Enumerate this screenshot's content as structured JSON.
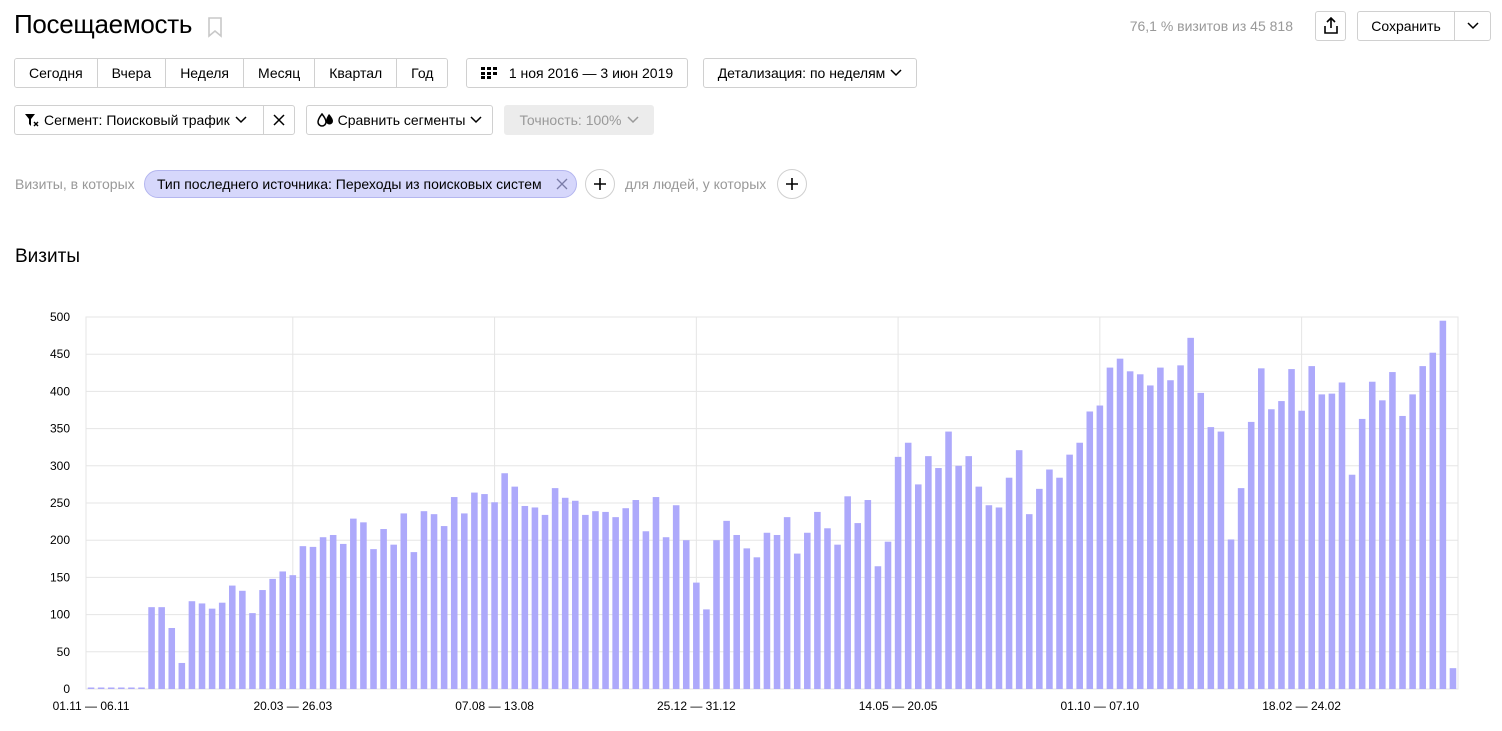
{
  "header": {
    "title": "Посещаемость",
    "stats": "76,1 % визитов из 45 818",
    "save_label": "Сохранить"
  },
  "period_buttons": [
    {
      "label": "Сегодня"
    },
    {
      "label": "Вчера"
    },
    {
      "label": "Неделя"
    },
    {
      "label": "Месяц"
    },
    {
      "label": "Квартал"
    },
    {
      "label": "Год"
    }
  ],
  "date_range": "1 ноя 2016 — 3 июн 2019",
  "detail": "Детализация: по неделям",
  "segment": {
    "label": "Сегмент: Поисковый трафик",
    "compare_label": "Сравнить сегменты",
    "accuracy_label": "Точность: 100%"
  },
  "filters": {
    "visits_label": "Визиты, в которых",
    "chip_label": "Тип последнего источника: Переходы из поисковых систем",
    "people_label": "для людей, у которых"
  },
  "icons": [
    "bookmark-icon",
    "share-icon",
    "chevron-down-icon",
    "calendar-icon",
    "filter-icon",
    "close-icon",
    "compare-icon",
    "plus-icon"
  ],
  "colors": {
    "bar": "#ada9fb",
    "grid": "#e5e5e5",
    "chip_bg": "#d6d7fb"
  },
  "chart_data": {
    "type": "bar",
    "title": "Визиты",
    "ylim": [
      0,
      500
    ],
    "yticks": [
      0,
      50,
      100,
      150,
      200,
      250,
      300,
      350,
      400,
      450,
      500
    ],
    "x_tick_labels": [
      {
        "index": 0,
        "label": "01.11 — 06.11"
      },
      {
        "index": 20,
        "label": "20.03 — 26.03"
      },
      {
        "index": 40,
        "label": "07.08 — 13.08"
      },
      {
        "index": 60,
        "label": "25.12 — 31.12"
      },
      {
        "index": 80,
        "label": "14.05 — 20.05"
      },
      {
        "index": 100,
        "label": "01.10 — 07.10"
      },
      {
        "index": 120,
        "label": "18.02 — 24.02"
      }
    ],
    "grid": true,
    "values": [
      2,
      2,
      2,
      2,
      2,
      2,
      110,
      110,
      82,
      35,
      118,
      115,
      108,
      116,
      139,
      132,
      102,
      133,
      148,
      158,
      153,
      192,
      191,
      204,
      207,
      195,
      229,
      224,
      188,
      215,
      194,
      236,
      184,
      239,
      235,
      219,
      258,
      236,
      264,
      262,
      251,
      290,
      272,
      246,
      244,
      234,
      270,
      257,
      253,
      234,
      239,
      238,
      231,
      243,
      254,
      212,
      258,
      204,
      247,
      200,
      143,
      107,
      200,
      226,
      207,
      189,
      177,
      210,
      207,
      231,
      182,
      210,
      238,
      216,
      194,
      259,
      223,
      254,
      165,
      198,
      312,
      331,
      275,
      313,
      297,
      346,
      300,
      313,
      272,
      247,
      244,
      284,
      321,
      235,
      269,
      295,
      284,
      315,
      331,
      373,
      381,
      432,
      444,
      427,
      423,
      408,
      432,
      415,
      435,
      472,
      398,
      352,
      346,
      201,
      270,
      359,
      431,
      376,
      387,
      430,
      374,
      434,
      396,
      397,
      412,
      288,
      363,
      413,
      388,
      426,
      367,
      396,
      434,
      452,
      495,
      28
    ]
  }
}
